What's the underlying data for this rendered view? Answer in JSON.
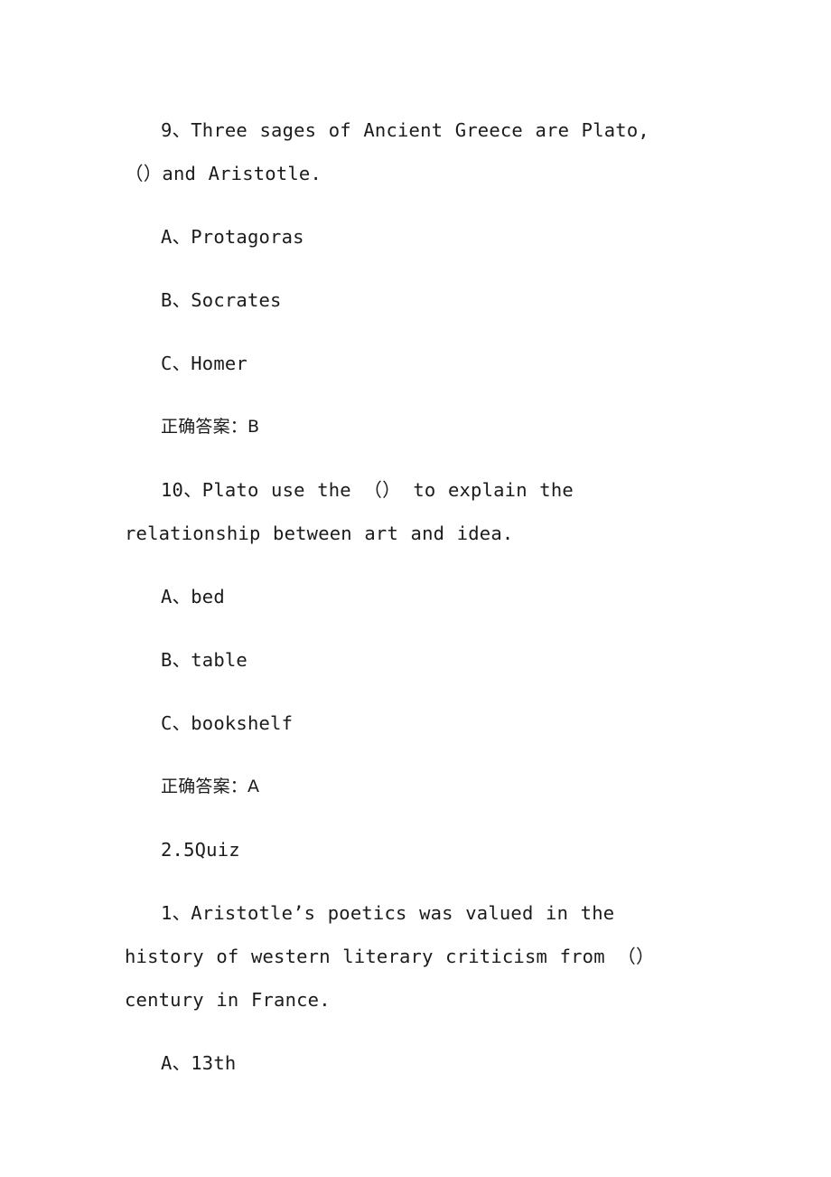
{
  "document": {
    "type": "quiz-answer-key",
    "background_color": "#ffffff",
    "text_color": "#1b1b1b",
    "blocks": [
      {
        "kind": "question",
        "name": "question-9",
        "text": "9、Three sages of Ancient Greece are Plato,（）and Aristotle."
      },
      {
        "kind": "option",
        "name": "question-9-option-a",
        "text": "A、Protagoras"
      },
      {
        "kind": "option",
        "name": "question-9-option-b",
        "text": "B、Socrates"
      },
      {
        "kind": "option",
        "name": "question-9-option-c",
        "text": "C、Homer"
      },
      {
        "kind": "answer",
        "name": "question-9-answer",
        "text": "正确答案：B"
      },
      {
        "kind": "question",
        "name": "question-10",
        "text": "10、Plato use the （） to explain the relationship between art and idea."
      },
      {
        "kind": "option",
        "name": "question-10-option-a",
        "text": "A、bed"
      },
      {
        "kind": "option",
        "name": "question-10-option-b",
        "text": "B、table"
      },
      {
        "kind": "option",
        "name": "question-10-option-c",
        "text": "C、bookshelf"
      },
      {
        "kind": "answer",
        "name": "question-10-answer",
        "text": "正确答案：A"
      },
      {
        "kind": "section-heading",
        "name": "section-heading-2-5-quiz",
        "text": "2.5Quiz"
      },
      {
        "kind": "question",
        "name": "question-1",
        "text": "1、Aristotle’s poetics was valued in the history of western literary criticism from （）century in France."
      },
      {
        "kind": "option",
        "name": "question-1-option-a",
        "text": "A、13th"
      }
    ]
  }
}
